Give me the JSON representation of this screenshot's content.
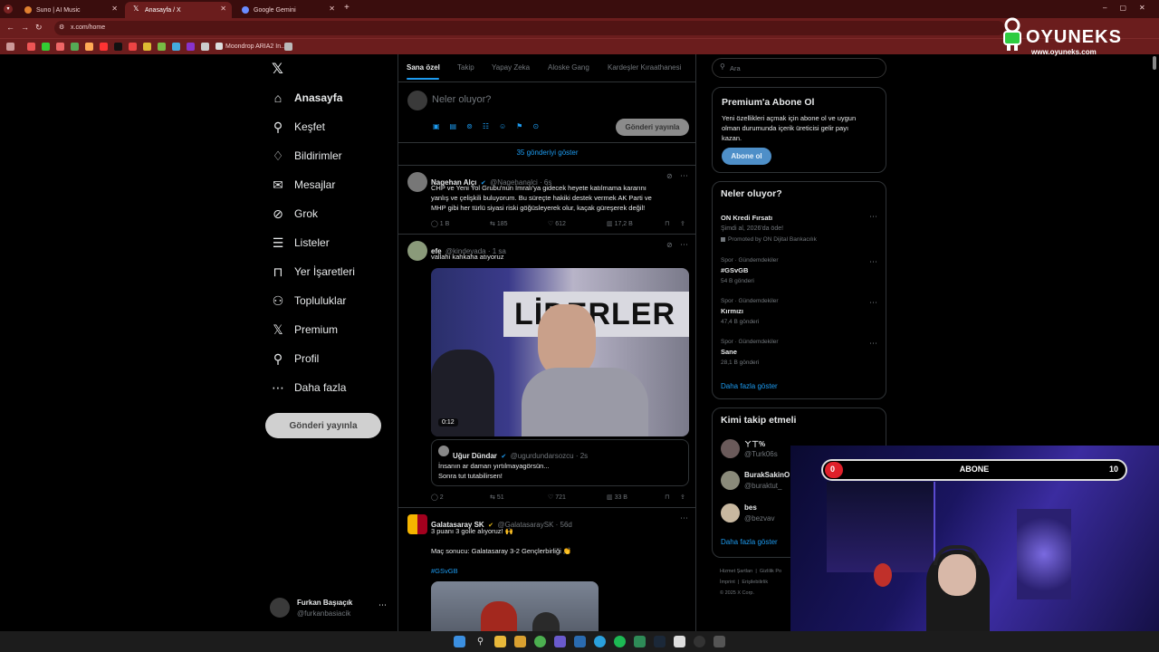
{
  "browser": {
    "tabs": [
      {
        "title": "Suno | AI Music"
      },
      {
        "title": "Anasayfa / X"
      },
      {
        "title": "Google Gemini"
      }
    ],
    "url": "x.com/home",
    "bookmark_label": "Moondrop ARIA2 In..."
  },
  "watermark": {
    "brand": "OYUNEKS",
    "site": "www.oyuneks.com"
  },
  "nav": {
    "items": [
      {
        "label": "Anasayfa",
        "icon": "home-icon"
      },
      {
        "label": "Keşfet",
        "icon": "search-icon"
      },
      {
        "label": "Bildirimler",
        "icon": "bell-icon"
      },
      {
        "label": "Mesajlar",
        "icon": "mail-icon"
      },
      {
        "label": "Grok",
        "icon": "grok-icon"
      },
      {
        "label": "Listeler",
        "icon": "list-icon"
      },
      {
        "label": "Yer İşaretleri",
        "icon": "bookmark-icon"
      },
      {
        "label": "Topluluklar",
        "icon": "people-icon"
      },
      {
        "label": "Premium",
        "icon": "x-logo-icon"
      },
      {
        "label": "Profil",
        "icon": "person-icon"
      },
      {
        "label": "Daha fazla",
        "icon": "more-circle-icon"
      }
    ],
    "post_button": "Gönderi yayınla",
    "account": {
      "name": "Furkan Başıaçık",
      "handle": "@furkanbasiacik"
    }
  },
  "feed": {
    "tabs": [
      "Sana özel",
      "Takip",
      "Yapay Zeka",
      "Aloske Gang",
      "Kardeşler Kıraathanesi"
    ],
    "compose_placeholder": "Neler oluyor?",
    "compose_button": "Gönderi yayınla",
    "show_more": "35 gönderiyi göster",
    "tweets": [
      {
        "name": "Nagehan Alçı",
        "handle": "@Nagehanalci · 6s",
        "text1": "CHP ve Yeni Yol Grubu'nun İmralı'ya gidecek heyete katılmama kararını",
        "text2": "yanlış ve çelişkili buluyorum. Bu süreçte hakiki destek vermek AK Parti ve",
        "text3": "MHP gibi her türlü siyasi riski göğüsleyerek olur, kaçak güreşerek değil!",
        "replies": "1 B",
        "reposts": "185",
        "likes": "612",
        "views": "17,2 B"
      },
      {
        "name": "efe",
        "handle": "@kindeyada · 1 sa",
        "text1": "vallahi kahkaha atıyoruz",
        "video_text": "LİDERLER",
        "video_time": "0:12",
        "quote_name": "Uğur Dündar",
        "quote_handle": "@ugurdundarsozcu · 2s",
        "quote_text1": "İnsanın ar damarı yırtılmayagörsün...",
        "quote_text2": "Sonra tut tutabilirsen!",
        "replies": "2",
        "reposts": "51",
        "likes": "721",
        "views": "33 B"
      },
      {
        "name": "Galatasaray SK",
        "handle": "@GalatasaraySK · 56d",
        "text1": "3 puanı 3 golle alıyoruz! 🙌",
        "text2": "Maç sonucu: Galatasaray 3-2 Gençlerbirliği 👏",
        "hashtag": "#GSvGB"
      }
    ]
  },
  "right": {
    "search_placeholder": "Ara",
    "premium": {
      "title": "Premium'a Abone Ol",
      "line1": "Yeni özellikleri açmak için abone ol ve uygun",
      "line2": "olman durumunda içerik üreticisi gelir payı",
      "line3": "kazan.",
      "button": "Abone ol"
    },
    "trends": {
      "title": "Neler oluyor?",
      "promo": {
        "name": "ON Kredi Fırsatı",
        "sub": "Şimdi al, 2026'da öde!",
        "promoted": "Promoted by ON Dijital Bankacılık"
      },
      "items": [
        {
          "cat": "Spor · Gündemdekiler",
          "name": "#GSvGB",
          "count": "54 B gönderi"
        },
        {
          "cat": "Spor · Gündemdekiler",
          "name": "Kırmızı",
          "count": "47,4 B gönderi"
        },
        {
          "cat": "Spor · Gündemdekiler",
          "name": "Sane",
          "count": "28,1 B gönderi"
        }
      ],
      "more": "Daha fazla göster"
    },
    "follow": {
      "title": "Kimi takip etmeli",
      "items": [
        {
          "name": "ㄚㄒ%",
          "handle": "@Turk06s"
        },
        {
          "name": "BurakSakinO",
          "handle": "@buraktut_"
        },
        {
          "name": "bes",
          "handle": "@bezvav"
        }
      ],
      "more": "Daha fazla göster"
    },
    "footer": {
      "l1": "Hizmet Şartları",
      "l2": "Gizlilik Po",
      "l3": "İmprint",
      "l4": "Erişilebilirlik",
      "copy": "© 2025 X Corp."
    }
  },
  "overlay": {
    "sub_label": "ABONE",
    "sub_current": "0",
    "sub_goal": "10"
  },
  "colors": {
    "accent": "#1d9bf0",
    "browser_frame": "#6b1d1d",
    "sub_red": "#e0202a"
  }
}
